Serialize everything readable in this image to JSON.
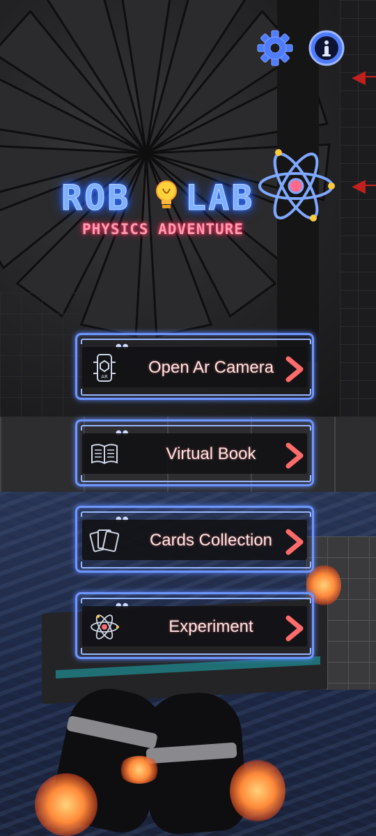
{
  "top_bar": {
    "settings_icon": "gear-icon",
    "info_icon": "info-icon",
    "icon_color": "#4f7cff"
  },
  "logo": {
    "title_left": "ROB",
    "title_right": "LAB",
    "subtitle": "PHYSICS ADVENTURE",
    "title_color": "#7fb0ff",
    "subtitle_color": "#ff9db0"
  },
  "menu": {
    "items": [
      {
        "label": "Open Ar Camera",
        "icon": "ar-phone-icon"
      },
      {
        "label": "Virtual Book",
        "icon": "book-icon"
      },
      {
        "label": "Cards Collection",
        "icon": "cards-icon"
      },
      {
        "label": "Experiment",
        "icon": "atom-icon"
      }
    ],
    "frame_color": "#6f96ff",
    "chevron_color": "#ff6a6a"
  }
}
